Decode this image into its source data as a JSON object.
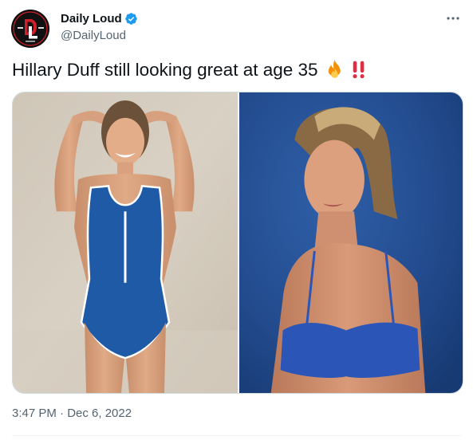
{
  "author": {
    "display_name": "Daily Loud",
    "handle": "@DailyLoud",
    "verified": true,
    "avatar_logo_text": "DL",
    "avatar_small_left": "DAILY",
    "avatar_small_right": "LOUD",
    "avatar_small_bottom": "Est. 2013"
  },
  "tweet": {
    "text": "Hillary Duff still looking great at age 35",
    "emojis": [
      "fire",
      "double-exclamation"
    ]
  },
  "media": {
    "count": 2,
    "photos": [
      {
        "subject": "woman in blue one-piece swimsuit against beige wall"
      },
      {
        "subject": "woman in blue bikini top against blue background"
      }
    ]
  },
  "meta": {
    "timestamp": "3:47 PM · Dec 6, 2022"
  },
  "colors": {
    "verified_blue": "#1d9bf0",
    "text_primary": "#0f1419",
    "text_secondary": "#536471",
    "avatar_red": "#d0202a"
  }
}
